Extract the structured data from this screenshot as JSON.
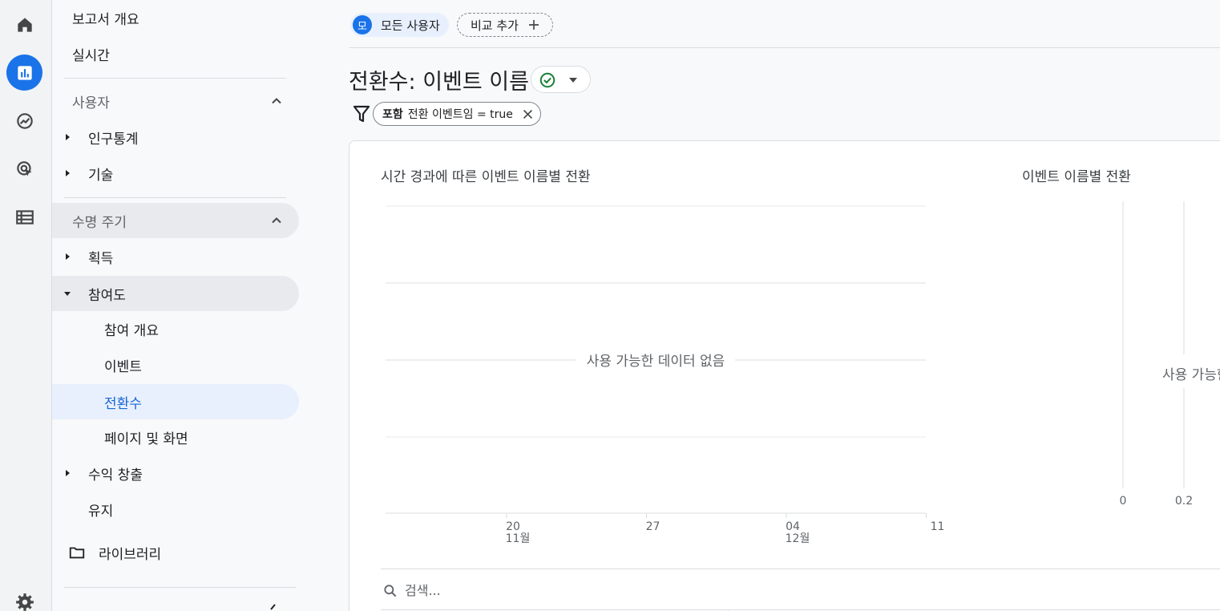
{
  "colors": {
    "accent": "#1a73e8",
    "current_bg": "#e8f0fe",
    "selected_bg": "#e8eaed",
    "success": "#188038"
  },
  "rail": {
    "items": [
      {
        "icon": "home-icon"
      },
      {
        "icon": "reports-icon",
        "active": true
      },
      {
        "icon": "explore-icon"
      },
      {
        "icon": "advertising-icon"
      },
      {
        "icon": "configure-icon"
      },
      {
        "icon": "settings-icon"
      }
    ]
  },
  "nav": {
    "reports_snapshot": "보고서 개요",
    "realtime": "실시간",
    "user_section": "사용자",
    "demographics": "인구통계",
    "tech": "기술",
    "lifecycle_section": "수명 주기",
    "acquisition": "획득",
    "engagement": "참여도",
    "engagement_overview": "참여 개요",
    "events": "이벤트",
    "conversions": "전환수",
    "pages_screens": "페이지 및 화면",
    "monetization": "수익 창출",
    "retention": "유지",
    "library": "라이브러리"
  },
  "header": {
    "segment_avatar": "모",
    "segment_label": "모든 사용자",
    "add_comparison": "비교 추가"
  },
  "report": {
    "title": "전환수: 이벤트 이름",
    "filter_include": "포함",
    "filter_value": "전환 이벤트임 = true"
  },
  "chart_data": [
    {
      "type": "line",
      "title": "시간 경과에 따른 이벤트 이름별 전환",
      "no_data": "사용 가능한 데이터 없음",
      "x_ticks": [
        {
          "day": "20",
          "month": "11월"
        },
        {
          "day": "27",
          "month": ""
        },
        {
          "day": "04",
          "month": "12월"
        },
        {
          "day": "11",
          "month": ""
        }
      ],
      "series": []
    },
    {
      "type": "bar",
      "title": "이벤트 이름별 전환",
      "no_data": "사용 가능한 데이터 없음",
      "x_ticks": [
        "0",
        "0.2"
      ],
      "series": []
    }
  ],
  "search": {
    "placeholder": "검색..."
  }
}
